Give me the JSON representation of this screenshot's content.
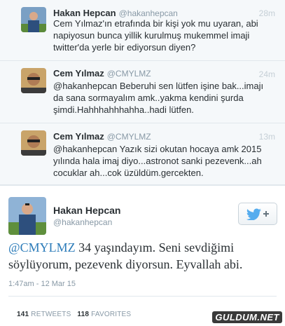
{
  "tweets": [
    {
      "name": "Hakan Hepcan",
      "handle": "@hakanhepcan",
      "time": "28m",
      "text": "Cem Yılmaz'ın etrafında bir kişi yok mu uyaran, abi napiyosun bunca yillik kurulmuş mukemmel imaji twitter'da yerle bir ediyorsun diyen?",
      "avatar": "user-avatar"
    },
    {
      "name": "Cem Yılmaz",
      "handle": "@CMYLMZ",
      "time": "24m",
      "text": "@hakanhepcan Beberuhi sen lütfen işine bak...imajı da sana sormayalım amk..yakma kendini şurda şimdi.Hahhhahhhahha..hadi lütfen.",
      "avatar": "user-avatar"
    },
    {
      "name": "Cem Yılmaz",
      "handle": "@CMYLMZ",
      "time": "13m",
      "text": "@hakanhepcan Yazık sizi okutan hocaya amk 2015 yılında hala imaj diyo...astronot sanki pezevenk...ah cocuklar ah...cok üzüldüm.gercekten.",
      "avatar": "user-avatar"
    }
  ],
  "main_tweet": {
    "name": "Hakan Hepcan",
    "handle": "@hakanhepcan",
    "mention": "@CMYLMZ",
    "text": " 34 yaşındayım. Seni sevdiğimi söylüyorum, pezevenk diyorsun. Eyvallah abi.",
    "timestamp": "1:47am - 12 Mar 15",
    "retweets_count": "141",
    "retweets_label": "RETWEETS",
    "favorites_count": "118",
    "favorites_label": "FAVORITES",
    "follow_icon": "follow-bird-plus-icon"
  },
  "watermark": "GULDUM.NET",
  "colors": {
    "link": "#2b7bb9",
    "muted": "#8899a6",
    "background_reply": "#f5f8fa",
    "twitter_blue": "#55acee"
  }
}
